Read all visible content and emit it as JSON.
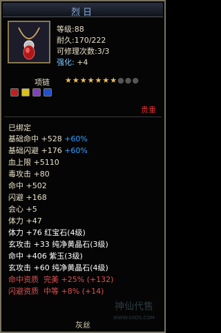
{
  "title": "烈日",
  "stats": {
    "level": "等级:88",
    "durability": "耐久:170/222",
    "repair": "可修理次数:3/3",
    "enhance_label": "强化:",
    "enhance_value": "+4"
  },
  "item_type": "项链",
  "stars": {
    "filled": 7,
    "total": 10
  },
  "gem_slots": [
    "ruby",
    "topaz",
    "amethyst",
    "sapphire"
  ],
  "quality_label": "贵重",
  "bound": "已绑定",
  "attributes": [
    {
      "text": "基础命中 +528",
      "bonus": "+60%"
    },
    {
      "text": "基础闪避 +176",
      "bonus": "+60%"
    },
    {
      "text": "血上限 +5110",
      "bonus": ""
    },
    {
      "text": "毒攻击 +80",
      "bonus": ""
    },
    {
      "text": "命中 +502",
      "bonus": ""
    },
    {
      "text": "闪避 +168",
      "bonus": ""
    },
    {
      "text": "会心 +5",
      "bonus": ""
    },
    {
      "text": "体力 +47",
      "bonus": ""
    }
  ],
  "gem_attributes": [
    "体力 +76 红宝石(4级)",
    "玄攻击 +33 纯净黄晶石(3级)",
    "命中 +406 紫玉(3级)",
    "玄攻击 +60 纯净黄晶石(4级)"
  ],
  "resistances": [
    {
      "label": "命中资质",
      "value": "完美 +25% (+132)"
    },
    {
      "label": "闪避资质",
      "value": "中等 +8% (+14)"
    }
  ],
  "footer": "灰丝",
  "watermark": {
    "brand": "神仙代售",
    "url": "WWW.SXDS.COM"
  },
  "colors": {
    "bonus": "#33a0ff",
    "precious": "#e03030",
    "resist": "#e05050",
    "title": "#8ab0e0"
  }
}
